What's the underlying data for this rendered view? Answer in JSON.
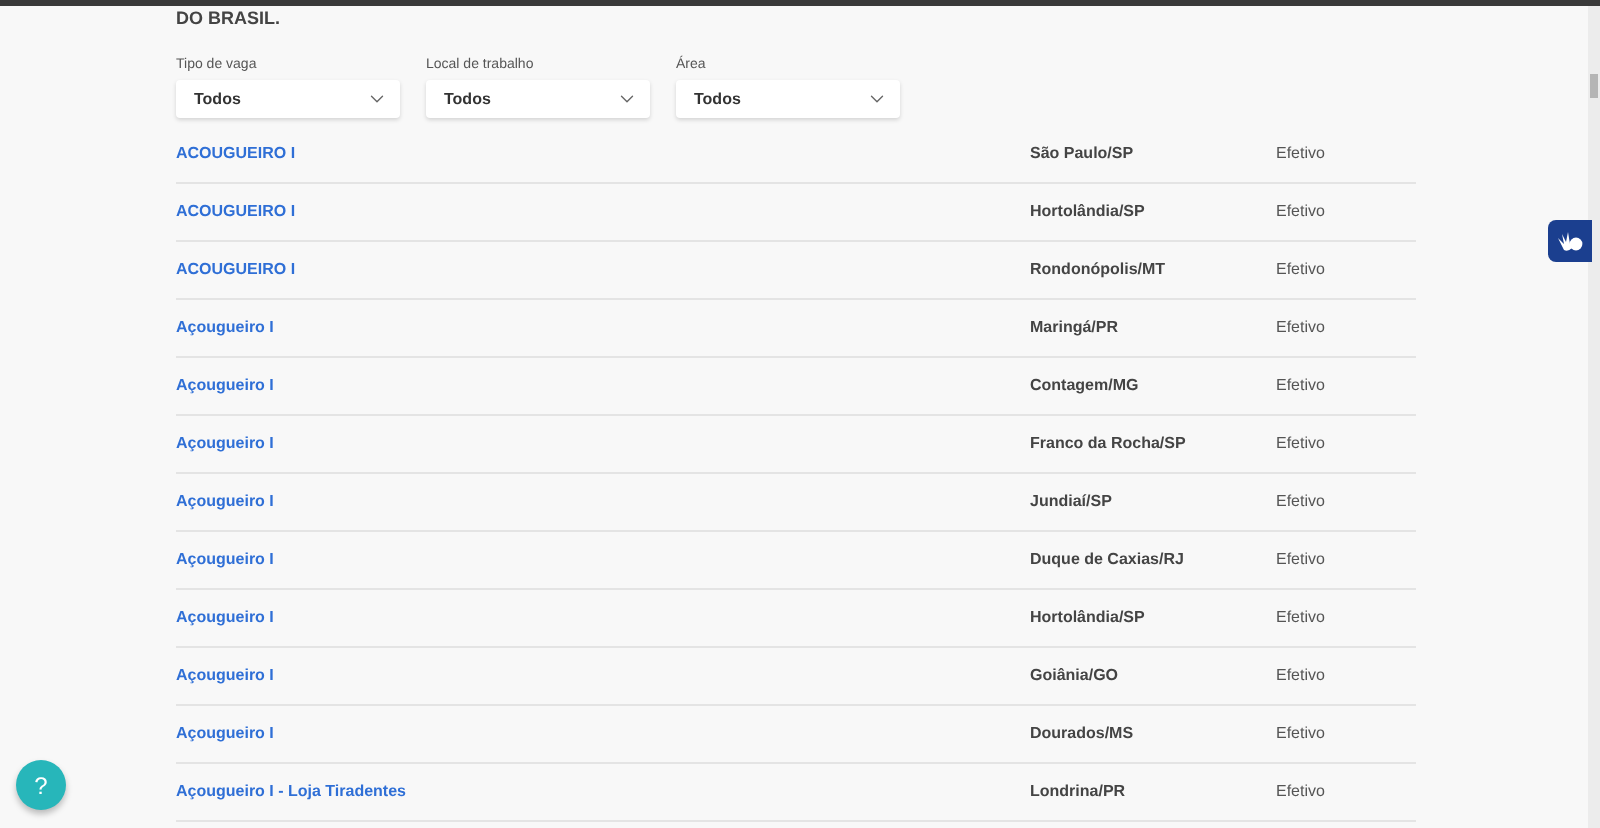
{
  "heading": "DO BRASIL.",
  "filters": [
    {
      "label": "Tipo de vaga",
      "value": "Todos"
    },
    {
      "label": "Local de trabalho",
      "value": "Todos"
    },
    {
      "label": "Área",
      "value": "Todos"
    }
  ],
  "jobs": [
    {
      "title": "ACOUGUEIRO I",
      "location": "São Paulo/SP",
      "type": "Efetivo"
    },
    {
      "title": "ACOUGUEIRO I",
      "location": "Hortolândia/SP",
      "type": "Efetivo"
    },
    {
      "title": "ACOUGUEIRO I",
      "location": "Rondonópolis/MT",
      "type": "Efetivo"
    },
    {
      "title": "Açougueiro I",
      "location": "Maringá/PR",
      "type": "Efetivo"
    },
    {
      "title": "Açougueiro I",
      "location": "Contagem/MG",
      "type": "Efetivo"
    },
    {
      "title": "Açougueiro I",
      "location": "Franco da Rocha/SP",
      "type": "Efetivo"
    },
    {
      "title": "Açougueiro I",
      "location": "Jundiaí/SP",
      "type": "Efetivo"
    },
    {
      "title": "Açougueiro I",
      "location": "Duque de Caxias/RJ",
      "type": "Efetivo"
    },
    {
      "title": "Açougueiro I",
      "location": "Hortolândia/SP",
      "type": "Efetivo"
    },
    {
      "title": "Açougueiro I",
      "location": "Goiânia/GO",
      "type": "Efetivo"
    },
    {
      "title": "Açougueiro I",
      "location": "Dourados/MS",
      "type": "Efetivo"
    },
    {
      "title": "Açougueiro I - Loja Tiradentes",
      "location": "Londrina/PR",
      "type": "Efetivo"
    }
  ],
  "help_button": {
    "label": "?"
  }
}
